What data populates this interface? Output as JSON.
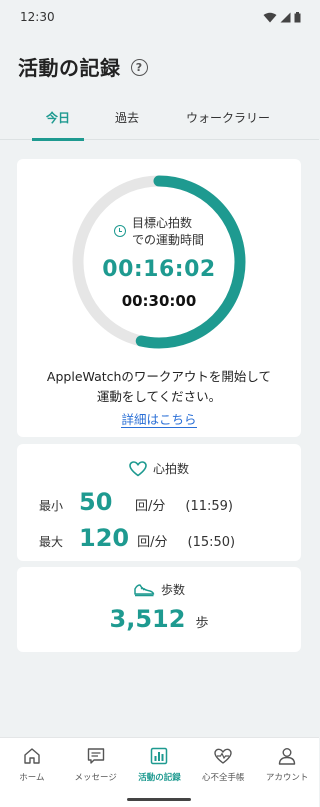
{
  "status_bar": {
    "time": "12:30"
  },
  "header": {
    "title": "活動の記録",
    "help_icon": "?"
  },
  "tabs": [
    {
      "label": "今日",
      "active": true
    },
    {
      "label": "過去",
      "active": false
    },
    {
      "label": "ウォークラリー",
      "active": false
    }
  ],
  "exercise": {
    "label_line1": "目標心拍数",
    "label_line2": "での運動時間",
    "elapsed": "00:16:02",
    "target": "00:30:00",
    "progress": 0.535,
    "message_line1": "AppleWatchのワークアウトを開始して",
    "message_line2": "運動をしてください。",
    "detail_link": "詳細はこちら"
  },
  "heart_rate": {
    "title": "心拍数",
    "min_label": "最小",
    "min_value": "50",
    "min_unit": "回/分",
    "min_time": "(11:59)",
    "max_label": "最大",
    "max_value": "120",
    "max_unit": "回/分",
    "max_time": "(15:50)"
  },
  "steps": {
    "title": "歩数",
    "value": "3,512",
    "unit": "歩"
  },
  "bottom_nav": [
    {
      "label": "ホーム",
      "icon": "home-icon",
      "active": false
    },
    {
      "label": "メッセージ",
      "icon": "message-icon",
      "active": false
    },
    {
      "label": "活動の記録",
      "icon": "activity-chart-icon",
      "active": true
    },
    {
      "label": "心不全手帳",
      "icon": "heart-notebook-icon",
      "active": false
    },
    {
      "label": "アカウント",
      "icon": "account-icon",
      "active": false
    }
  ],
  "colors": {
    "accent": "#1e9a90",
    "ring_track": "#e6e6e6",
    "link": "#2a6fd6",
    "background": "#eff2f3"
  }
}
